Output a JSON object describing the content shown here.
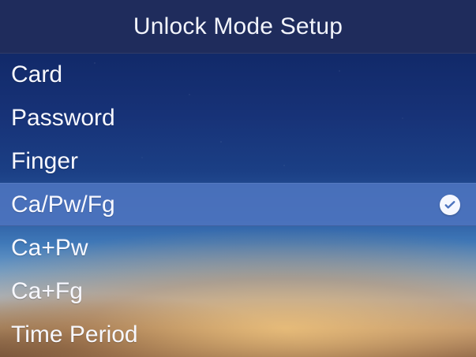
{
  "header": {
    "title": "Unlock Mode Setup"
  },
  "menu": {
    "items": [
      {
        "label": "Card",
        "selected": false
      },
      {
        "label": "Password",
        "selected": false
      },
      {
        "label": "Finger",
        "selected": false
      },
      {
        "label": "Ca/Pw/Fg",
        "selected": true
      },
      {
        "label": "Ca+Pw",
        "selected": false
      },
      {
        "label": "Ca+Fg",
        "selected": false
      },
      {
        "label": "Time Period",
        "selected": false
      }
    ],
    "selected_icon": "check-circle-icon"
  },
  "colors": {
    "title_bar": "#1f2c5c",
    "selected_row": "#4c73be",
    "text": "#f7f8ff"
  }
}
